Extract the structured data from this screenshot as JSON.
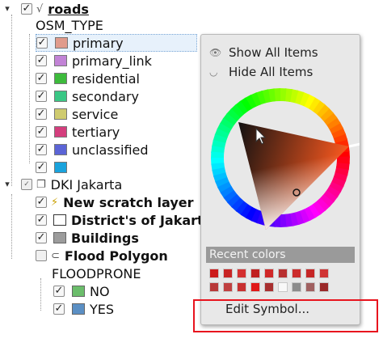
{
  "tree": {
    "roads_layer": {
      "label": "roads"
    },
    "osm_type_label": "OSM_TYPE",
    "categories": [
      {
        "label": "primary",
        "color": "#e09b8c"
      },
      {
        "label": "primary_link",
        "color": "#c283d6"
      },
      {
        "label": "residential",
        "color": "#3dbb3c"
      },
      {
        "label": "secondary",
        "color": "#3ac785"
      },
      {
        "label": "service",
        "color": "#cfcb6f"
      },
      {
        "label": "tertiary",
        "color": "#d43e7d"
      },
      {
        "label": "unclassified",
        "color": "#5b64d6"
      },
      {
        "label": "",
        "color": "#1aa3dd"
      }
    ],
    "group": {
      "label": "DKI Jakarta"
    },
    "layers": [
      {
        "label": "New scratch layer"
      },
      {
        "label": "District's of Jakarta"
      },
      {
        "label": "Buildings"
      },
      {
        "label": "Flood Polygon"
      }
    ],
    "floodprone_label": "FLOODPRONE",
    "flood_classes": [
      {
        "label": "NO",
        "color": "#6bbd6b"
      },
      {
        "label": "YES",
        "color": "#5b8fc4"
      }
    ]
  },
  "popup": {
    "show_all": "Show All Items",
    "hide_all": "Hide All Items",
    "recent_colors_label": "Recent colors",
    "recent_colors": [
      [
        "#cc1a1a",
        "#c82424",
        "#d43030",
        "#c02020",
        "#d02828",
        "#b83030",
        "#cc2c2c",
        "#c62626",
        "#d03434"
      ],
      [
        "#b83838",
        "#c04040",
        "#c83030",
        "#e01818",
        "#a83030",
        "#f8f8f8",
        "#8c8c8c",
        "#a06060",
        "#9a2828"
      ]
    ],
    "edit_symbol": "Edit Symbol..."
  }
}
